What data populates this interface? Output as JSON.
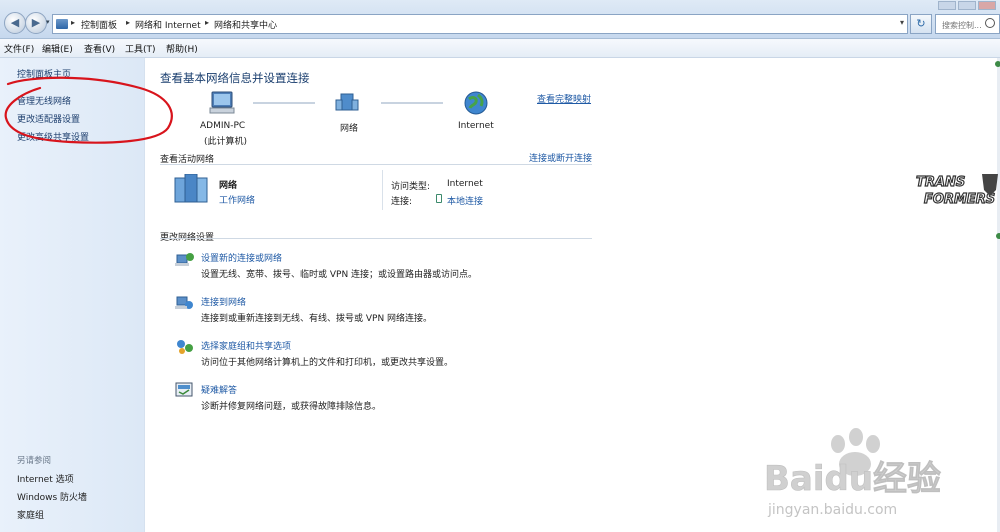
{
  "addressbar": {
    "breadcrumbs": [
      "控制面板",
      "网络和 Internet",
      "网络和共享中心"
    ],
    "search_placeholder": "搜索控制..."
  },
  "menubar": {
    "items": [
      "文件(F)",
      "编辑(E)",
      "查看(V)",
      "工具(T)",
      "帮助(H)"
    ]
  },
  "leftpane": {
    "links": [
      "控制面板主页",
      "管理无线网络",
      "更改适配器设置",
      "更改高级共享设置"
    ],
    "see_also_title": "另请参阅",
    "see_also": [
      "Internet 选项",
      "Windows 防火墙",
      "家庭组"
    ]
  },
  "main": {
    "title": "查看基本网络信息并设置连接",
    "view_full_map": "查看完整映射",
    "map": {
      "computer_name": "ADMIN-PC",
      "computer_sub": "(此计算机)",
      "network": "网络",
      "internet": "Internet"
    },
    "active_section": {
      "heading": "查看活动网络",
      "action": "连接或断开连接",
      "network_name": "网络",
      "network_type": "工作网络",
      "access_type_label": "访问类型:",
      "access_type_value": "Internet",
      "connection_label": "连接:",
      "connection_value": "本地连接"
    },
    "change_section": {
      "heading": "更改网络设置",
      "tasks": [
        {
          "title": "设置新的连接或网络",
          "desc": "设置无线、宽带、拨号、临时或 VPN 连接；或设置路由器或访问点。",
          "icon": "setup-connection-icon"
        },
        {
          "title": "连接到网络",
          "desc": "连接到或重新连接到无线、有线、拨号或 VPN 网络连接。",
          "icon": "connect-network-icon"
        },
        {
          "title": "选择家庭组和共享选项",
          "desc": "访问位于其他网络计算机上的文件和打印机，或更改共享设置。",
          "icon": "homegroup-icon"
        },
        {
          "title": "疑难解答",
          "desc": "诊断并修复网络问题，或获得故障排除信息。",
          "icon": "troubleshoot-icon"
        }
      ]
    }
  },
  "overlays": {
    "logo_line1": "TRANS",
    "logo_line2": "FORMERS",
    "watermark_brand": "Baidu经验",
    "watermark_url": "jingyan.baidu.com"
  },
  "colors": {
    "link": "#1f5aa5",
    "title": "#1b3f6f",
    "annotation_circle": "#d8141c"
  }
}
